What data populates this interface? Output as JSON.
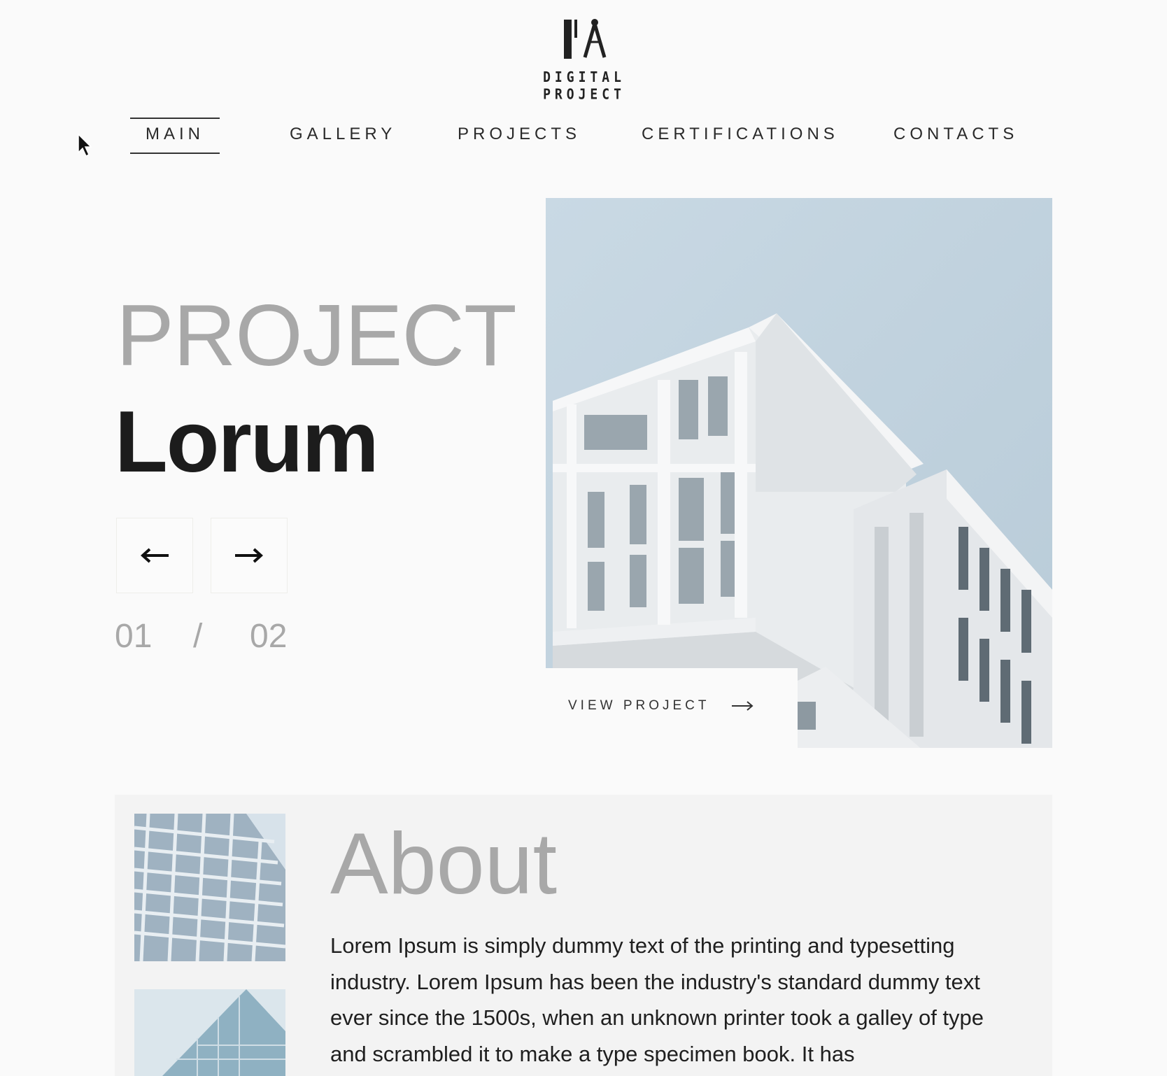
{
  "brand": {
    "name": "DIGITAL PROJECT"
  },
  "nav": {
    "items": [
      {
        "label": "MAIN",
        "active": true
      },
      {
        "label": "GALLERY",
        "active": false
      },
      {
        "label": "PROJECTS",
        "active": false
      },
      {
        "label": "CERTIFICATIONS",
        "active": false
      },
      {
        "label": "CONTACTS",
        "active": false
      }
    ]
  },
  "hero": {
    "kicker": "PROJECT",
    "title": "Lorum",
    "prev_icon": "arrow-left-icon",
    "next_icon": "arrow-right-icon",
    "counter": {
      "current": "01",
      "separator": "/",
      "total": "02"
    },
    "cta_label": "VIEW PROJECT",
    "cta_icon": "long-arrow-right-icon"
  },
  "about": {
    "title": "About",
    "text": "Lorem Ipsum is simply dummy text of the printing and typesetting industry. Lorem Ipsum has been the industry's standard dummy text ever since the 1500s, when an unknown printer took a galley of type and scrambled it to make a type specimen book. It has"
  },
  "colors": {
    "background": "#fafafa",
    "sky": "#c0d1dd",
    "muted_text": "#a8a8a8",
    "dark_text": "#1c1c1c"
  }
}
